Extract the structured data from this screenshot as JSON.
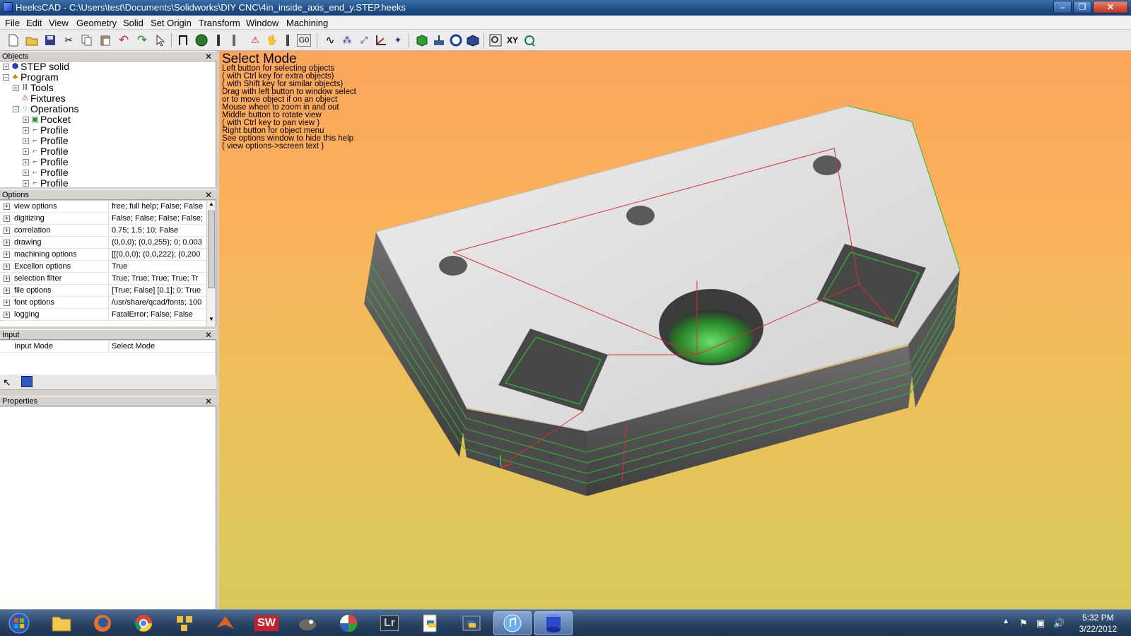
{
  "window": {
    "title": "HeeksCAD - C:\\Users\\test\\Documents\\Solidworks\\DIY CNC\\4in_inside_axis_end_y.STEP.heeks",
    "min_label": "–",
    "max_label": "❐",
    "close_label": "✕"
  },
  "menu": [
    "File",
    "Edit",
    "View",
    "Geometry",
    "Solid",
    "Set Origin",
    "Transform",
    "Window",
    "Machining"
  ],
  "toolbar": {
    "icons": [
      "new-icon",
      "open-icon",
      "save-icon",
      "cut-icon",
      "copy-icon",
      "paste-icon",
      "undo-icon",
      "redo-icon",
      "select-icon",
      "sketch-icon",
      "circle-solid-icon",
      "line-icon",
      "point-icon",
      "error-icon",
      "tool-icon",
      "drill-icon",
      "g0-icon",
      "spline-icon",
      "dots-icon",
      "dash-icon",
      "axis-icon",
      "coord-icon",
      "cube-icon",
      "extrude-icon",
      "sphere-icon",
      "revolve-icon",
      "zoom-icon",
      "xy-icon",
      "rotate-icon"
    ],
    "g0_label": "G0",
    "xy_label": "XY"
  },
  "objects_panel": {
    "title": "Objects",
    "close": "✕",
    "tree": [
      {
        "label": "STEP solid",
        "exp": "+"
      },
      {
        "label": "Program",
        "exp": "−"
      },
      {
        "label": "Tools",
        "exp": "+"
      },
      {
        "label": "Fixtures",
        "exp": ""
      },
      {
        "label": "Operations",
        "exp": "−"
      },
      {
        "label": "Pocket",
        "exp": "+"
      },
      {
        "label": "Profile",
        "exp": "+"
      },
      {
        "label": "Profile",
        "exp": "+"
      },
      {
        "label": "Profile",
        "exp": "+"
      },
      {
        "label": "Profile",
        "exp": "+"
      },
      {
        "label": "Profile",
        "exp": "+"
      },
      {
        "label": "Profile",
        "exp": "+"
      }
    ]
  },
  "options_panel": {
    "title": "Options",
    "close": "✕",
    "rows": [
      {
        "name": "view options",
        "value": "free; full help; False; False"
      },
      {
        "name": "digitizing",
        "value": "False; False; False; False;"
      },
      {
        "name": "correlation",
        "value": "0.75; 1.5; 10; False"
      },
      {
        "name": "drawing",
        "value": "(0,0,0); (0,0,255); 0; 0.003"
      },
      {
        "name": "machining options",
        "value": "[[(0,0,0); (0,0,222); (0,200"
      },
      {
        "name": "Excellon options",
        "value": "True"
      },
      {
        "name": "selection filter",
        "value": "True; True; True; True; Tr"
      },
      {
        "name": "file options",
        "value": "[True; False] [0.1]; 0; True"
      },
      {
        "name": "font options",
        "value": "/usr/share/qcad/fonts; 100"
      },
      {
        "name": "logging",
        "value": "FatalError; False; False"
      }
    ]
  },
  "input_panel": {
    "title": "Input",
    "close": "✕",
    "mode_label": "Input Mode",
    "mode_value": "Select Mode"
  },
  "properties_panel": {
    "title": "Properties",
    "close": "✕"
  },
  "viewport": {
    "help_title": "Select Mode",
    "help_lines": [
      "Left button for selecting objects",
      "( with Ctrl key for extra objects)",
      "( with Shift key for similar objects)",
      "Drag with left button to window select",
      "or to move object if on an object",
      "Mouse wheel to zoom in and out",
      "Middle button to rotate view",
      "( with Ctrl key to pan view )",
      "Right button for object menu",
      "See options window to hide this help",
      "( view options->screen text )"
    ],
    "colors": {
      "background_top": "#fca65c",
      "background_bottom": "#d6c95a",
      "toolpath_green": "#2dbb2d",
      "toolpath_red": "#d83030"
    }
  },
  "taskbar": {
    "apps": [
      "windows-start-icon",
      "explorer-icon",
      "firefox-icon",
      "chrome-icon",
      "network-app-icon",
      "matlab-icon",
      "solidworks-icon",
      "gimp-icon",
      "picasa-icon",
      "lightroom-icon",
      "python-icon",
      "python-shell-icon",
      "itunes-icon",
      "heekscad-icon"
    ],
    "sw_label": "SW",
    "lr_label": "Lr",
    "time": "5:32 PM",
    "date": "3/22/2012"
  }
}
